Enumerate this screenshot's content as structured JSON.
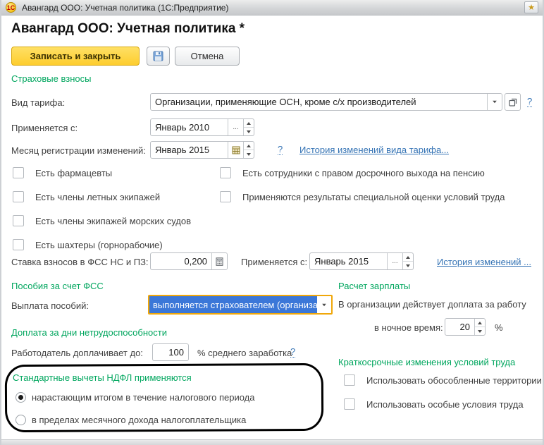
{
  "window": {
    "title": "Авангард ООО: Учетная политика  (1С:Предприятие)",
    "app_logo": "1С",
    "page_title": "Авангард ООО: Учетная политика *"
  },
  "toolbar": {
    "save_close_label": "Записать и закрыть",
    "cancel_label": "Отмена"
  },
  "insurance": {
    "header": "Страховые взносы",
    "tariff_label": "Вид тарифа:",
    "tariff_value": "Организации, применяющие ОСН, кроме с/х производителей",
    "tariff_help": "?",
    "applies_from_label": "Применяется с:",
    "applies_from_value": "Январь 2010",
    "applies_from_more": "...",
    "reg_month_label": "Месяц регистрации изменений:",
    "reg_month_value": "Январь 2015",
    "reg_month_help": "?",
    "history_link": "История изменений вида тарифа...",
    "checkboxes_left": [
      {
        "label": "Есть фармацевты",
        "checked": false
      },
      {
        "label": "Есть члены летных экипажей",
        "checked": false
      },
      {
        "label": "Есть члены экипажей морских судов",
        "checked": false
      },
      {
        "label": "Есть шахтеры (горнорабочие)",
        "checked": false
      }
    ],
    "checkboxes_right": [
      {
        "label": "Есть сотрудники с правом досрочного выхода на пенсию",
        "checked": false
      },
      {
        "label": "Применяются результаты специальной оценки условий труда",
        "checked": false
      }
    ],
    "fss_rate_label": "Ставка взносов в ФСС НС и ПЗ:",
    "fss_rate_value": "0,200",
    "fss_applies_label": "Применяется с:",
    "fss_applies_value": "Январь 2015",
    "fss_applies_more": "...",
    "fss_history_link": "История изменений ..."
  },
  "benefits": {
    "header": "Пособия за счет ФСС",
    "payment_label": "Выплата пособий:",
    "payment_value": "выполняется страхователем (организа"
  },
  "salary": {
    "header": "Расчет зарплаты",
    "line1": "В организации действует доплата за работу",
    "night_label": "в ночное время:",
    "night_value": "20",
    "percent": "%"
  },
  "disability": {
    "header": "Доплата за дни нетрудоспособности",
    "label": "Работодатель доплачивает до:",
    "value": "100",
    "suffix": "% среднего заработка",
    "help": "?"
  },
  "ndfl": {
    "header": "Стандартные вычеты НДФЛ применяются",
    "options": [
      {
        "label": "нарастающим итогом в течение налогового периода",
        "selected": true
      },
      {
        "label": "в пределах месячного дохода налогоплательщика",
        "selected": false
      }
    ]
  },
  "short_term": {
    "header": "Краткосрочные изменения условий труда",
    "checkboxes": [
      {
        "label": "Использовать обособленные территории",
        "checked": false
      },
      {
        "label": "Использовать особые условия труда",
        "checked": false
      }
    ]
  },
  "colors": {
    "section_header": "#00a65e",
    "link": "#3674b5",
    "primary_button": "#fdcd2e",
    "focus_border": "#f0a70a",
    "selection_bg": "#3b77d8"
  }
}
